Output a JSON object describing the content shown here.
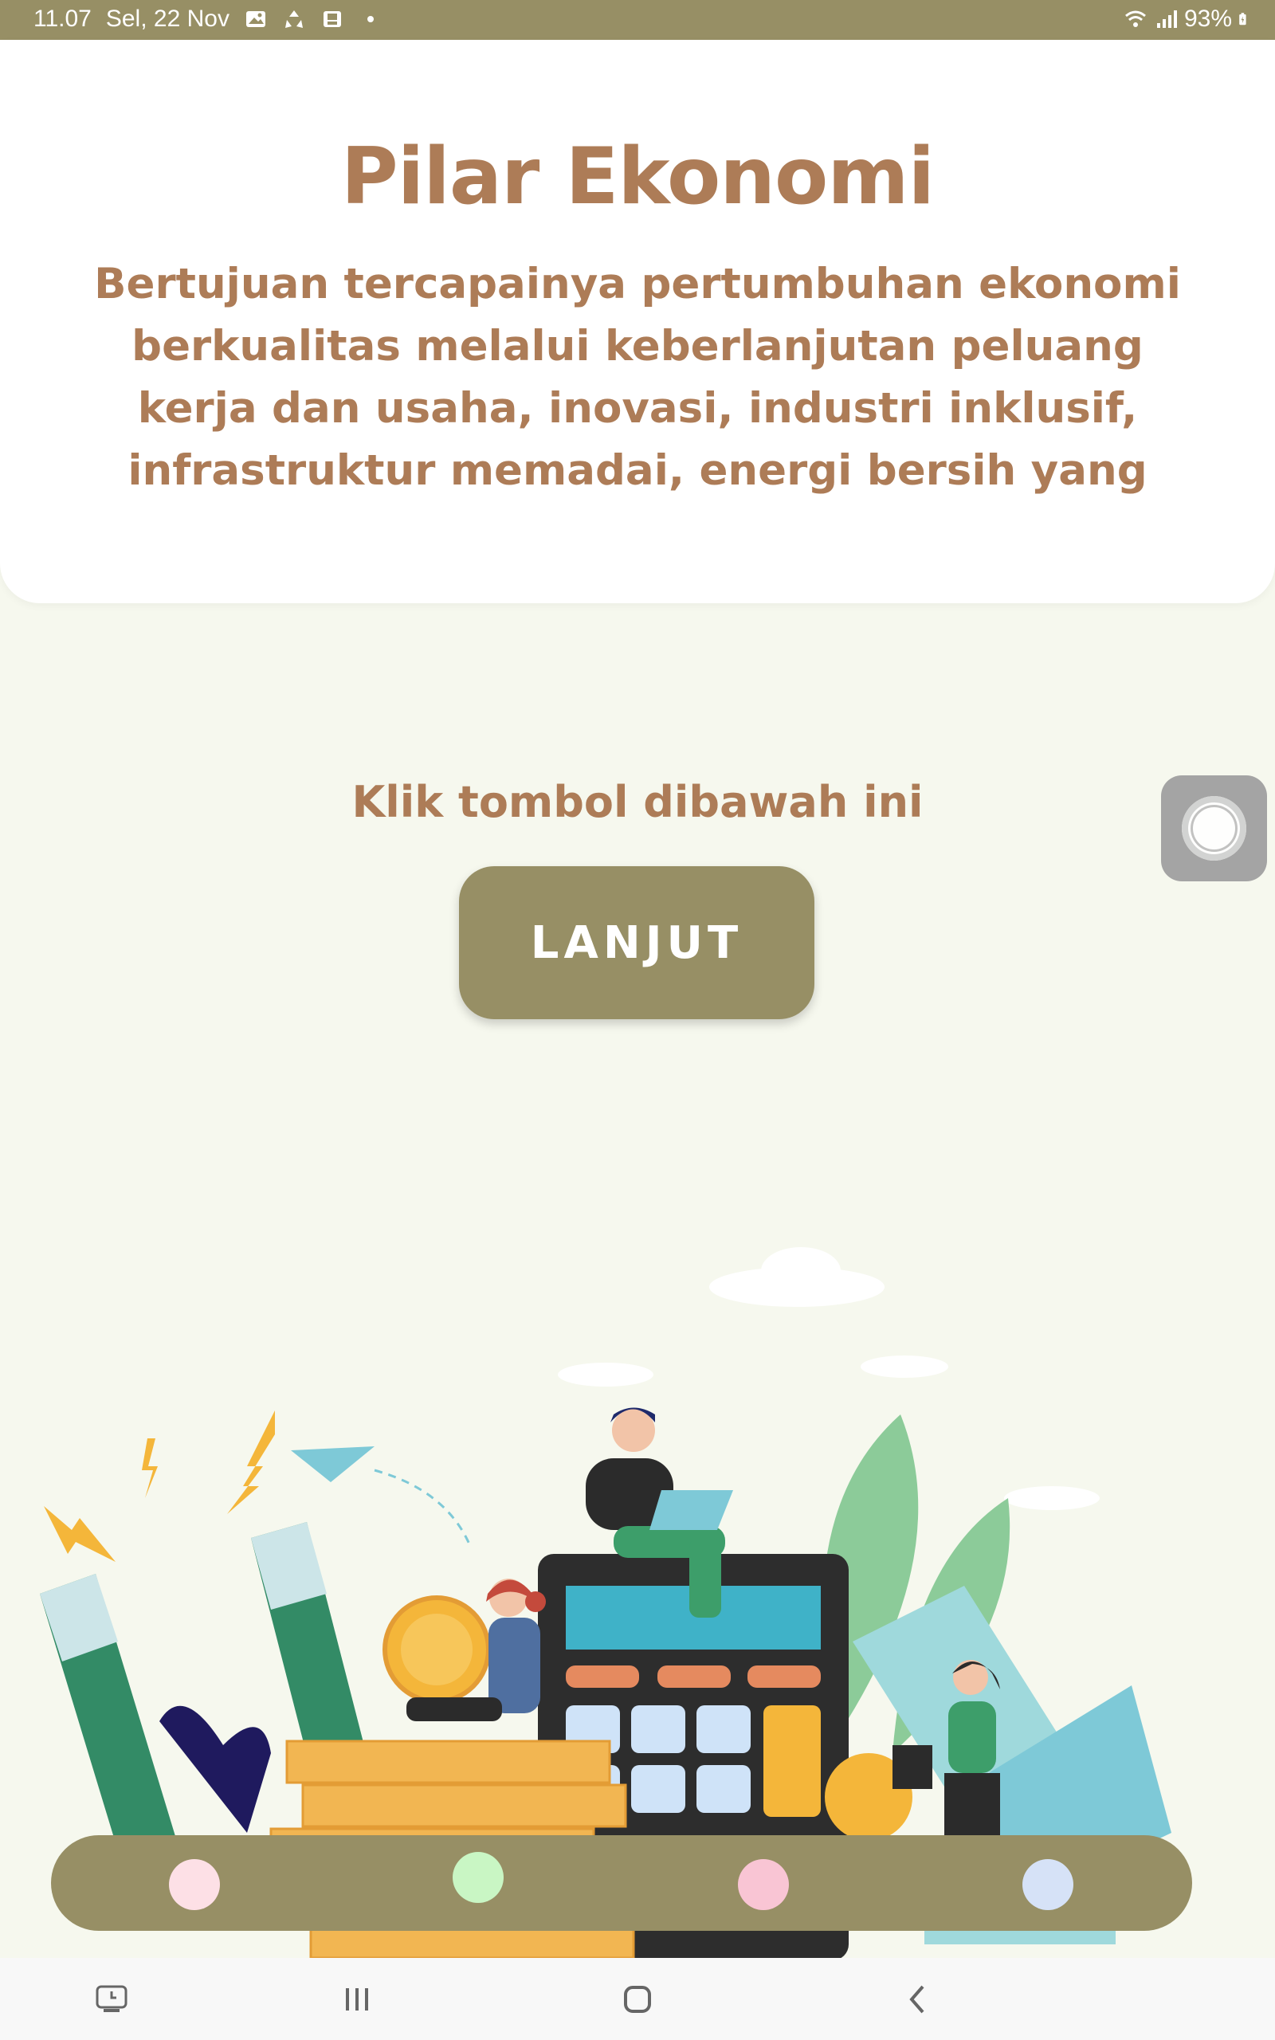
{
  "status_bar": {
    "time": "11.07",
    "date": "Sel, 22 Nov",
    "battery": "93%",
    "icons": [
      "gallery-icon",
      "sync-icon",
      "screenshot-icon",
      "dot-icon",
      "wifi-icon",
      "signal-icon",
      "battery-icon"
    ]
  },
  "header": {
    "title": "Pilar Ekonomi",
    "description": "Bertujuan tercapainya pertumbuhan ekonomi berkualitas melalui keberlanjutan peluang kerja dan usaha, inovasi, industri inklusif, infrastruktur memadai, energi bersih yang"
  },
  "main": {
    "instruction": "Klik tombol dibawah ini",
    "button_label": "LANJUT"
  },
  "tab_bar": {
    "dots": [
      {
        "name": "tab-dot-1",
        "color": "#fde0e6"
      },
      {
        "name": "tab-dot-2",
        "color": "#c9f6c4"
      },
      {
        "name": "tab-dot-3",
        "color": "#f9c5d4"
      },
      {
        "name": "tab-dot-4",
        "color": "#d6e2f7"
      }
    ]
  },
  "nav_bar": {
    "buttons": [
      "recent-apps-icon",
      "menu-lines-icon",
      "home-icon",
      "back-icon"
    ]
  },
  "colors": {
    "accent": "#978f65",
    "text_brown": "#ad7c57",
    "background": "#f6f8ee"
  }
}
